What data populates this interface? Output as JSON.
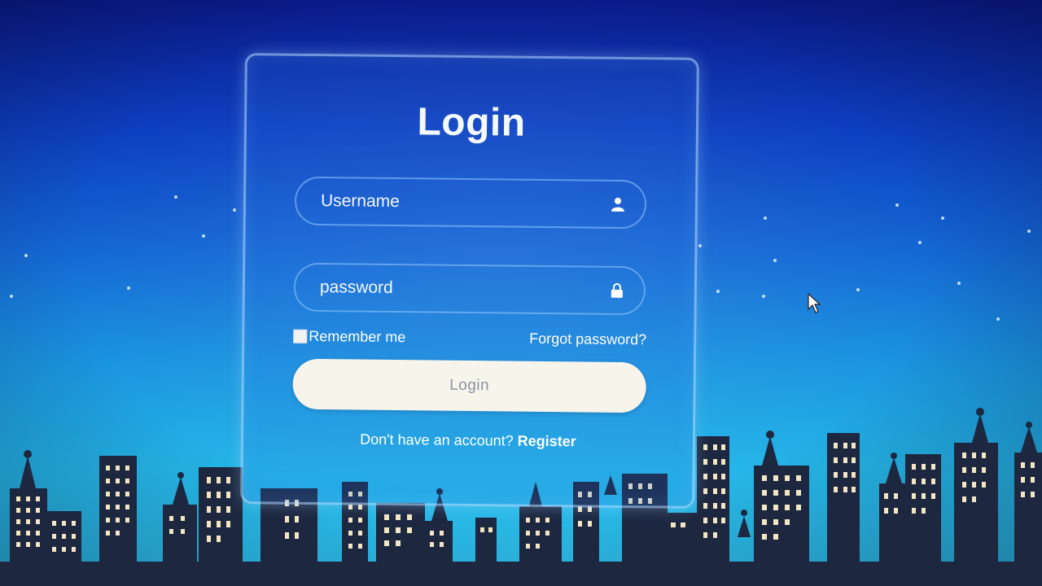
{
  "login": {
    "title": "Login",
    "username_placeholder": "Username",
    "password_placeholder": "password",
    "remember_label": "Remember me",
    "forgot_label": "Forgot password?",
    "button_label": "Login",
    "register_prompt": "Don't have an account?",
    "register_link": "Register"
  },
  "icons": {
    "username": "user-icon",
    "password": "lock-icon",
    "cursor": "mouse-pointer-icon"
  },
  "colors": {
    "background_top": "#0b1b8c",
    "background_bottom": "#2fc0ea",
    "button_bg": "#f7f4ec",
    "button_text": "#8b93a0",
    "text": "#ffffff",
    "skyline": "#1d2740",
    "windows": "#f3e6c4"
  }
}
